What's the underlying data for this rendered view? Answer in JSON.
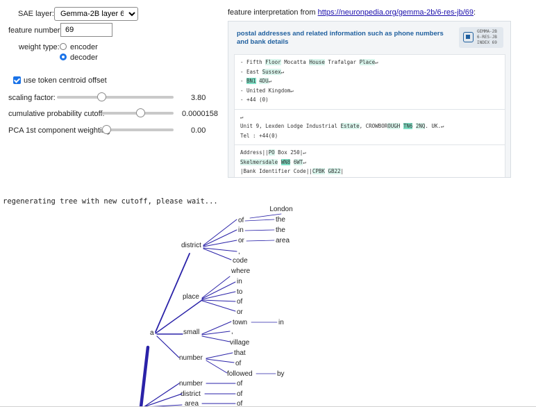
{
  "controls": {
    "sae_layer_label": "SAE layer:",
    "sae_layer_value": "Gemma-2B layer 6",
    "feature_number_label": "feature number:",
    "feature_number_value": "69",
    "weight_type_label": "weight type:",
    "weight_options": [
      "encoder",
      "decoder"
    ],
    "weight_selected": "decoder",
    "token_centroid_label": "use token centroid offset",
    "token_centroid_checked": true,
    "sliders": [
      {
        "label": "scaling factor:",
        "display": "3.80",
        "fraction": 0.38
      },
      {
        "label": "cumulative probability cutoff:",
        "display": "0.0000158",
        "fraction": 0.75
      },
      {
        "label": "PCA 1st component weighting",
        "display": "0.00",
        "fraction": 0.0
      }
    ]
  },
  "feature_panel": {
    "prefix": "feature interpretation from ",
    "link_text": "https://neuronpedia.org/gemma-2b/6-res-jb/69",
    "suffix": ":",
    "title": "postal addresses and related information such as phone numbers and bank details",
    "badge_text": "GEMMA-2B\n6-RES-JB\nINDEX 69",
    "colors": {
      "title": "#1f5f9e",
      "highlight_light": "#d9f5ec",
      "highlight_strong": "#7fe0c6"
    }
  },
  "examples": [
    {
      "lines": [
        [
          [
            "- Fifth ",
            0
          ],
          [
            "Floor",
            1
          ],
          [
            " Mocatta ",
            0
          ],
          [
            "House",
            1
          ],
          [
            " Trafalgar ",
            0
          ],
          [
            "Place",
            1
          ],
          [
            "↵",
            0
          ]
        ],
        [
          [
            "- East ",
            0
          ],
          [
            "Sussex",
            1
          ],
          [
            "↵",
            0
          ]
        ],
        [
          [
            "- ",
            0
          ],
          [
            "BN1",
            2
          ],
          [
            " ",
            0
          ],
          [
            "4DU",
            1
          ],
          [
            "↵",
            0
          ]
        ],
        [
          [
            "- United Kingdom↵",
            0
          ]
        ],
        [
          [
            "- +44 (0)",
            0
          ]
        ]
      ]
    },
    {
      "lines": [
        [
          [
            "↵",
            0
          ]
        ],
        [
          [
            "Unit 9, Lexden Lodge Industrial ",
            0
          ],
          [
            "Estate",
            1
          ],
          [
            ", CROWBOR",
            0
          ],
          [
            "OUGH",
            1
          ],
          [
            " ",
            0
          ],
          [
            "TN6",
            2
          ],
          [
            " ",
            0
          ],
          [
            "2NQ",
            1
          ],
          [
            ". UK.↵",
            0
          ]
        ],
        [
          [
            "Tel : +44(0)",
            0
          ]
        ]
      ]
    },
    {
      "lines": [
        [
          [
            "Address||",
            0
          ],
          [
            "PO",
            1
          ],
          [
            " Box 250|↵",
            0
          ]
        ],
        [
          [
            "Skelmersdale",
            1
          ],
          [
            " ",
            0
          ],
          [
            "WN8",
            2
          ],
          [
            " ",
            0
          ],
          [
            "6WT",
            1
          ],
          [
            "↵",
            0
          ]
        ],
        [
          [
            "|Bank Identifier Code||",
            0
          ],
          [
            "CPBK",
            1
          ],
          [
            " ",
            0
          ],
          [
            "GB22",
            1
          ],
          [
            "|",
            0
          ]
        ]
      ]
    },
    {
      "lines": [
        [
          [
            "↵",
            0
          ]
        ]
      ]
    }
  ],
  "status_text": "regenerating tree with new cutoff, please wait...",
  "tree": {
    "edge_color": "#2a22a8",
    "words": [
      "London",
      "of",
      "the",
      "in",
      "the",
      "or",
      "area",
      "district",
      ",",
      "code",
      "where",
      "in",
      "to",
      "of",
      "or",
      "place",
      "town",
      "in",
      "a",
      ",",
      "small",
      "village",
      "that",
      "number",
      "of",
      "followed",
      "by",
      "number",
      "of",
      "district",
      "of",
      "area",
      "of"
    ]
  }
}
